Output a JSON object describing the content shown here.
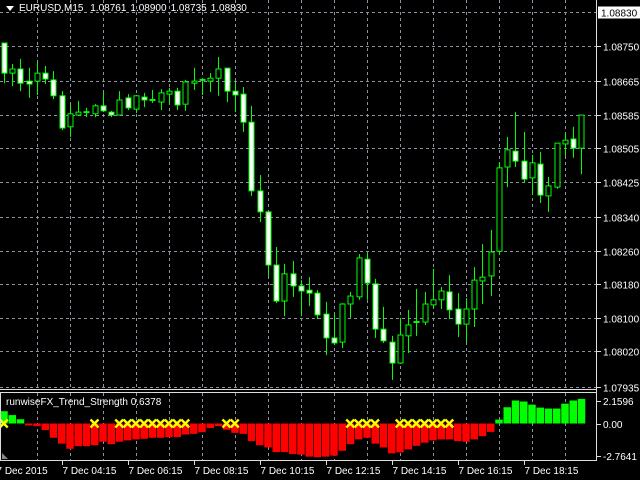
{
  "header": {
    "symbol": "EURUSD,M15",
    "open": "1.08761",
    "high": "1.08900",
    "low": "1.08735",
    "close": "1.08830"
  },
  "price_axis": {
    "current": "1.08830",
    "labels": [
      "1.08750",
      "1.08665",
      "1.08585",
      "1.08505",
      "1.08425",
      "1.08340",
      "1.08260",
      "1.08180",
      "1.08100",
      "1.08020",
      "1.07935"
    ]
  },
  "indicator": {
    "name": "runwiseFX_Trend_Strength",
    "value": "0.6378",
    "axis_labels": [
      "2.1596",
      "0.00",
      "-2.7641"
    ],
    "values": [
      1.37,
      1.13,
      0.77,
      0.39,
      -0.18,
      -0.24,
      -0.6,
      -1.31,
      -1.85,
      -2.32,
      -2.08,
      -2.08,
      -1.99,
      -1.67,
      -1.9,
      -1.67,
      -1.55,
      -1.46,
      -1.4,
      -1.31,
      -1.31,
      -1.25,
      -1.25,
      -1.01,
      -0.95,
      -0.8,
      -0.42,
      -0.24,
      -0.57,
      -0.86,
      -0.95,
      -1.61,
      -1.99,
      -2.2,
      -2.62,
      -2.62,
      -2.8,
      -2.86,
      -3.04,
      -3.1,
      -3.04,
      -2.95,
      -2.5,
      -1.9,
      -1.46,
      -1.31,
      -1.85,
      -2.2,
      -2.74,
      -2.65,
      -2.38,
      -2.05,
      -1.76,
      -1.55,
      -1.46,
      -1.46,
      -1.61,
      -1.67,
      -1.46,
      -1.16,
      -0.77,
      0.36,
      1.49,
      2.11,
      2.02,
      1.73,
      1.46,
      1.37,
      1.37,
      1.82,
      2.11,
      2.26
    ],
    "cross_markers": [
      0,
      1,
      12,
      15,
      16,
      17,
      18,
      19,
      20,
      21,
      22,
      23,
      28,
      29,
      43,
      44,
      45,
      46,
      49,
      50,
      51,
      52,
      53,
      54,
      55
    ],
    "colors": {
      "up": "#00FF00",
      "down": "#FF0000",
      "marker": "#FFFF00"
    }
  },
  "time_axis": {
    "labels": [
      "7 Dec 2015",
      "7 Dec 04:15",
      "7 Dec 06:15",
      "7 Dec 08:15",
      "7 Dec 10:15",
      "7 Dec 12:15",
      "7 Dec 14:15",
      "7 Dec 16:15",
      "7 Dec 18:15"
    ]
  },
  "colors": {
    "background": "#000000",
    "bull": "#00FF00",
    "bear_body": "#FFFFFF",
    "grid": "#8C93A0"
  },
  "candles": [
    [
      1.08811,
      1.08823,
      1.08715,
      1.0873
    ],
    [
      1.08756,
      1.08756,
      1.0866,
      1.08684
    ],
    [
      1.08684,
      1.08706,
      1.08653,
      1.08694
    ],
    [
      1.08694,
      1.08718,
      1.08641,
      1.0866
    ],
    [
      1.08665,
      1.08697,
      1.08625,
      1.08658
    ],
    [
      1.08665,
      1.08711,
      1.08632,
      1.08684
    ],
    [
      1.08684,
      1.08701,
      1.08658,
      1.0867
    ],
    [
      1.08668,
      1.08689,
      1.08622,
      1.0863
    ],
    [
      1.0863,
      1.08641,
      1.08548,
      1.08553
    ],
    [
      1.08556,
      1.08608,
      1.08532,
      1.08587
    ],
    [
      1.08584,
      1.08618,
      1.08582,
      1.08591
    ],
    [
      1.08591,
      1.08601,
      1.08579,
      1.08589
    ],
    [
      1.08587,
      1.0861,
      1.08579,
      1.08606
    ],
    [
      1.08606,
      1.08639,
      1.08591,
      1.08594
    ],
    [
      1.08591,
      1.08594,
      1.08579,
      1.08584
    ],
    [
      1.08584,
      1.08641,
      1.08584,
      1.0862
    ],
    [
      1.08625,
      1.08634,
      1.08596,
      1.08601
    ],
    [
      1.08598,
      1.08632,
      1.08589,
      1.0863
    ],
    [
      1.08627,
      1.08637,
      1.08603,
      1.0862
    ],
    [
      1.0862,
      1.08644,
      1.08613,
      1.08618
    ],
    [
      1.08615,
      1.08646,
      1.08596,
      1.08637
    ],
    [
      1.08634,
      1.08649,
      1.0861,
      1.08641
    ],
    [
      1.08641,
      1.08649,
      1.08596,
      1.08608
    ],
    [
      1.0861,
      1.08668,
      1.08594,
      1.08663
    ],
    [
      1.0866,
      1.08697,
      1.08644,
      1.08665
    ],
    [
      1.08665,
      1.08672,
      1.08632,
      1.08668
    ],
    [
      1.08665,
      1.08684,
      1.08639,
      1.08672
    ],
    [
      1.08672,
      1.08723,
      1.0863,
      1.08694
    ],
    [
      1.08696,
      1.08696,
      1.08615,
      1.08641
    ],
    [
      1.08641,
      1.08665,
      1.08591,
      1.08632
    ],
    [
      1.08634,
      1.08651,
      1.08544,
      1.08567
    ],
    [
      1.08567,
      1.08606,
      1.08391,
      1.08403
    ],
    [
      1.08403,
      1.08441,
      1.08329,
      1.08353
    ],
    [
      1.08353,
      1.08353,
      1.08197,
      1.08226
    ],
    [
      1.08226,
      1.08269,
      1.08135,
      1.0814
    ],
    [
      1.0814,
      1.08229,
      1.08104,
      1.08205
    ],
    [
      1.08205,
      1.08236,
      1.0815,
      1.08176
    ],
    [
      1.08176,
      1.0819,
      1.08104,
      1.08164
    ],
    [
      1.08166,
      1.08197,
      1.08128,
      1.08159
    ],
    [
      1.08159,
      1.08166,
      1.08097,
      1.08107
    ],
    [
      1.08109,
      1.08138,
      1.08011,
      1.08052
    ],
    [
      1.08052,
      1.08109,
      1.08035,
      1.0804
    ],
    [
      1.08042,
      1.08135,
      1.08028,
      1.08133
    ],
    [
      1.08133,
      1.08162,
      1.081,
      1.08152
    ],
    [
      1.0815,
      1.08252,
      1.08143,
      1.08243
    ],
    [
      1.0824,
      1.08255,
      1.08143,
      1.08183
    ],
    [
      1.08181,
      1.08193,
      1.08052,
      1.08073
    ],
    [
      1.08073,
      1.08126,
      1.0804,
      1.08045
    ],
    [
      1.08042,
      1.08057,
      1.07952,
      1.07992
    ],
    [
      1.07992,
      1.081,
      1.0799,
      1.08059
    ],
    [
      1.08057,
      1.08119,
      1.08016,
      1.08083
    ],
    [
      1.08088,
      1.08169,
      1.08057,
      1.0809
    ],
    [
      1.0809,
      1.08162,
      1.08083,
      1.08133
    ],
    [
      1.08131,
      1.08217,
      1.08123,
      1.08143
    ],
    [
      1.08143,
      1.08174,
      1.08121,
      1.08164
    ],
    [
      1.08162,
      1.08202,
      1.08097,
      1.08119
    ],
    [
      1.08121,
      1.08159,
      1.08054,
      1.08085
    ],
    [
      1.08085,
      1.08147,
      1.08042,
      1.08121
    ],
    [
      1.08121,
      1.08221,
      1.08078,
      1.0819
    ],
    [
      1.08188,
      1.08276,
      1.08133,
      1.08197
    ],
    [
      1.082,
      1.0831,
      1.08152,
      1.08257
    ],
    [
      1.08259,
      1.08472,
      1.0825,
      1.08458
    ],
    [
      1.0846,
      1.08532,
      1.08412,
      1.08501
    ],
    [
      1.08498,
      1.08591,
      1.0846,
      1.08474
    ],
    [
      1.08474,
      1.08544,
      1.08422,
      1.08431
    ],
    [
      1.08434,
      1.08489,
      1.08393,
      1.0847
    ],
    [
      1.08467,
      1.08496,
      1.08374,
      1.08393
    ],
    [
      1.08391,
      1.08436,
      1.08353,
      1.08415
    ],
    [
      1.08412,
      1.08517,
      1.08408,
      1.08517
    ],
    [
      1.08515,
      1.08541,
      1.08486,
      1.08524
    ],
    [
      1.08527,
      1.08556,
      1.08482,
      1.08505
    ],
    [
      1.08505,
      1.08584,
      1.08443,
      1.08584
    ]
  ]
}
